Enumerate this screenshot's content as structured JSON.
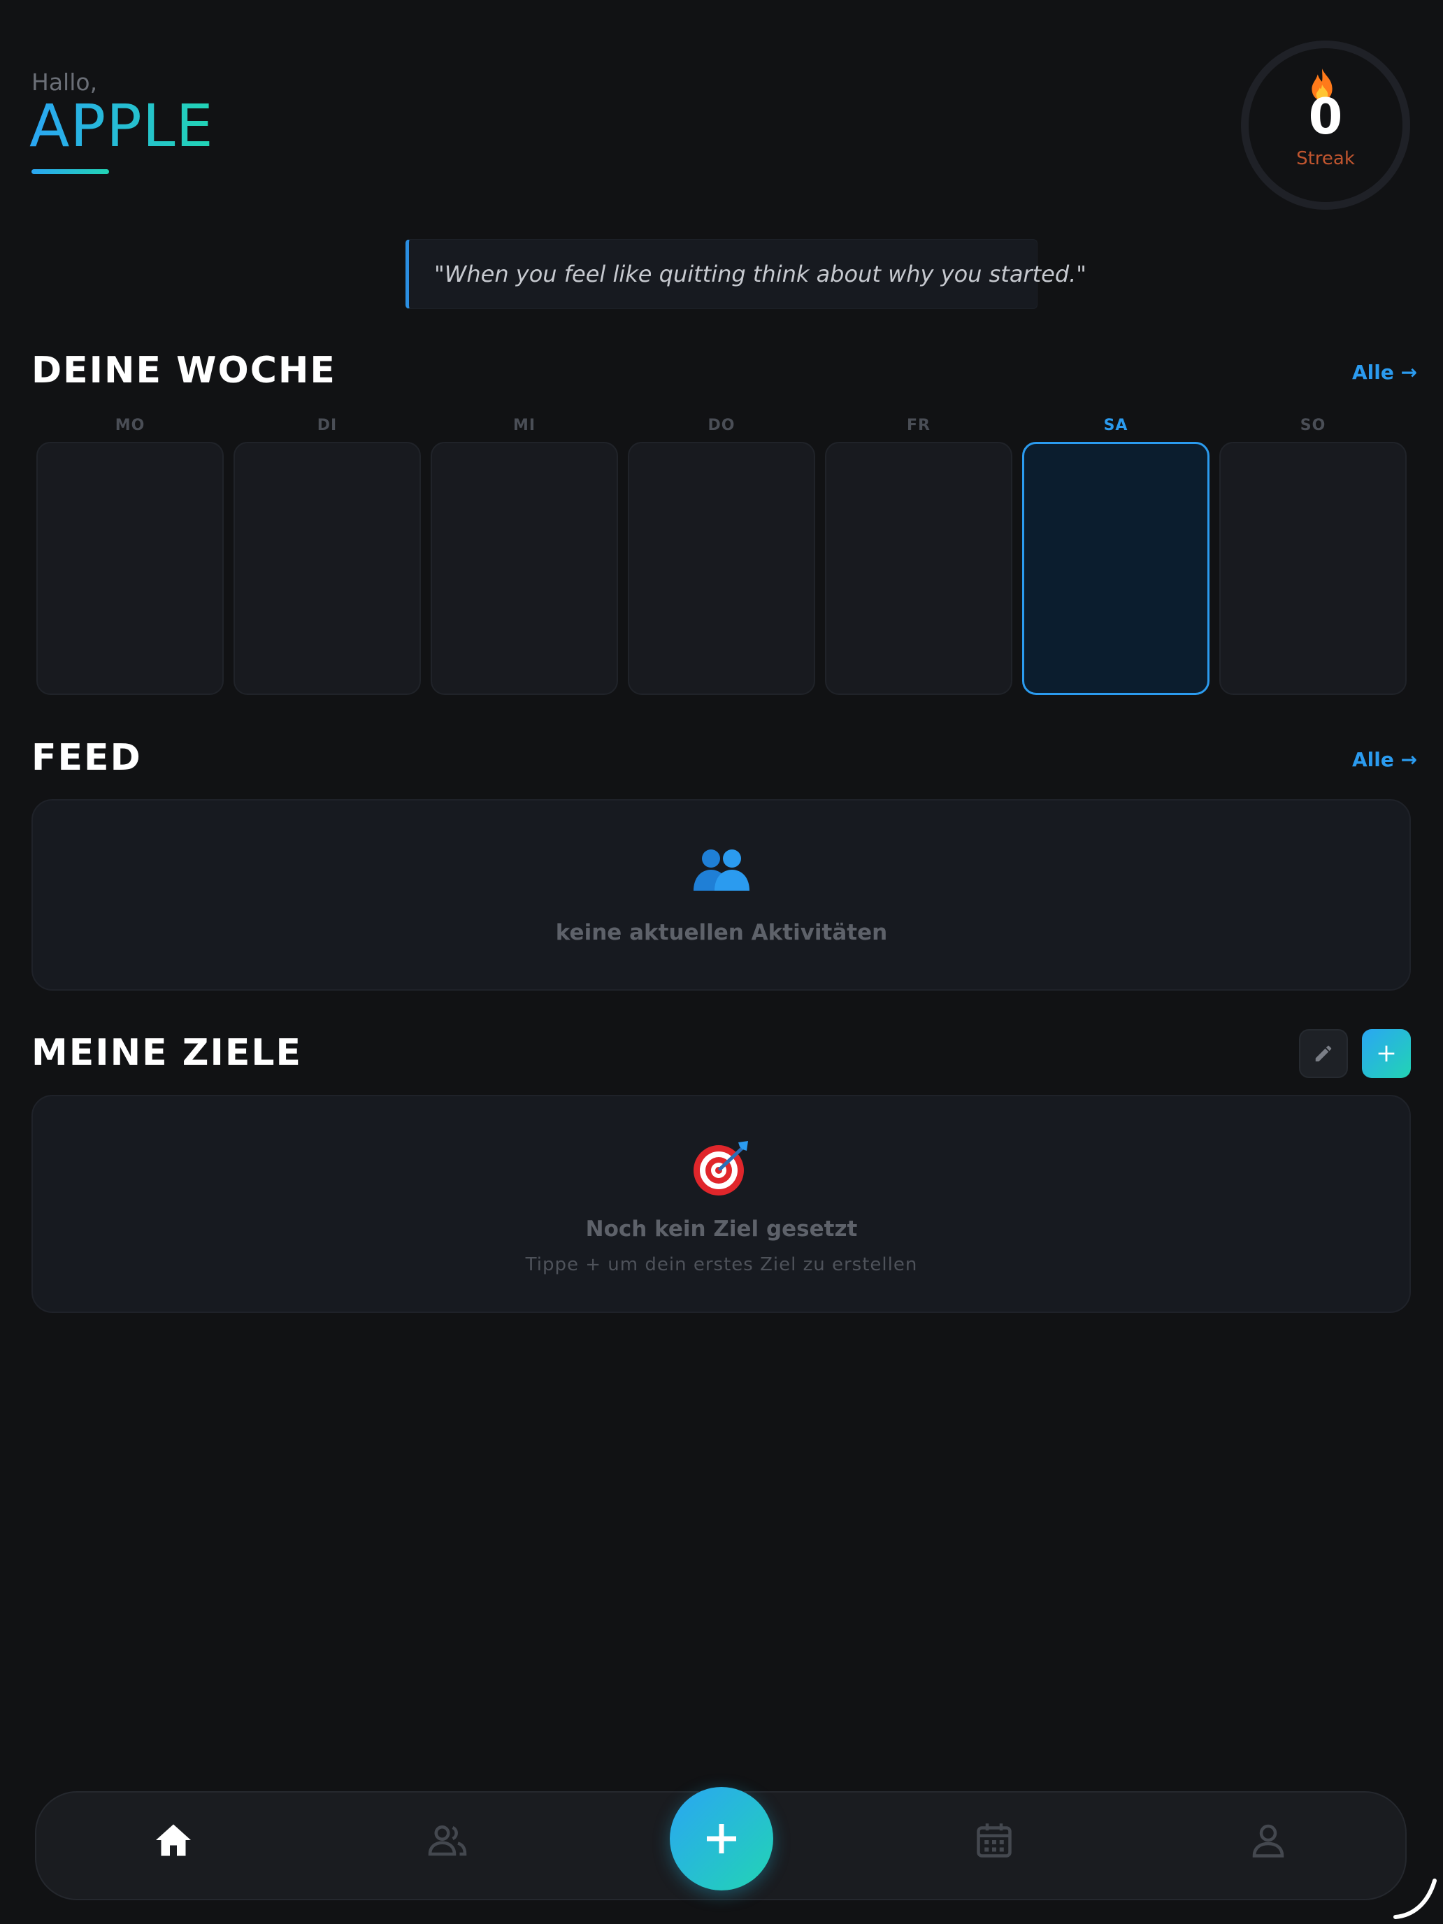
{
  "header": {
    "greeting": "Hallo,",
    "user_name": "APPLE",
    "streak": {
      "value": "0",
      "label": "Streak",
      "icon": "fire-icon"
    }
  },
  "quote": "\"When you feel like quitting think about why you started.\"",
  "week": {
    "title": "DEINE WOCHE",
    "all_link": "Alle →",
    "days": [
      {
        "label": "MO",
        "active": false
      },
      {
        "label": "DI",
        "active": false
      },
      {
        "label": "MI",
        "active": false
      },
      {
        "label": "DO",
        "active": false
      },
      {
        "label": "FR",
        "active": false
      },
      {
        "label": "SA",
        "active": true
      },
      {
        "label": "SO",
        "active": false
      }
    ]
  },
  "feed": {
    "title": "FEED",
    "all_link": "Alle →",
    "empty_icon": "people-icon",
    "empty_text": "keine aktuellen Aktivitäten"
  },
  "goals": {
    "title": "MEINE ZIELE",
    "edit_icon": "pencil-icon",
    "add_icon": "plus-icon",
    "empty_icon": "target-icon",
    "empty_title": "Noch kein Ziel gesetzt",
    "empty_subtitle": "Tippe + um dein erstes Ziel zu erstellen"
  },
  "nav": {
    "items": [
      "home-icon",
      "friends-icon",
      "add-icon",
      "calendar-icon",
      "profile-icon"
    ],
    "active": "home-icon"
  },
  "colors": {
    "background": "#111214",
    "accent_blue": "#2b9bef",
    "accent_teal": "#22d4b4",
    "streak_label": "#c0552f"
  }
}
